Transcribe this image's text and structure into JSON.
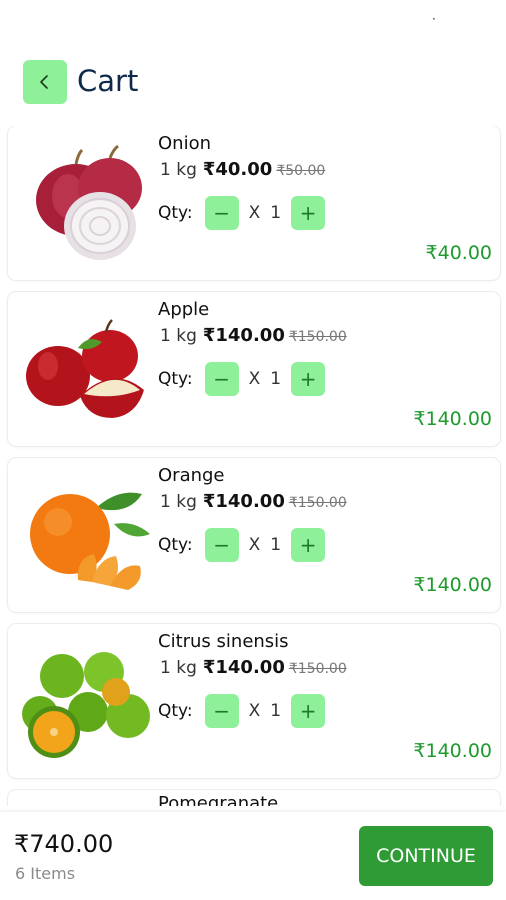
{
  "status": {
    "indicator": "·"
  },
  "header": {
    "back_icon": "chevron-left-icon",
    "title": "Cart"
  },
  "colors": {
    "accent_green": "#8ff09a",
    "price_green": "#1f9a2e",
    "button_green": "#2e9b35"
  },
  "cart": {
    "qty_label": "Qty:",
    "minus": "−",
    "plus": "+",
    "times": "X",
    "items": [
      {
        "name": "Onion",
        "unit": "1 kg",
        "price": "₹40.00",
        "mrp": "₹50.00",
        "quantity": "1",
        "total": "₹40.00",
        "image": "onion"
      },
      {
        "name": "Apple",
        "unit": "1 kg",
        "price": "₹140.00",
        "mrp": "₹150.00",
        "quantity": "1",
        "total": "₹140.00",
        "image": "apple"
      },
      {
        "name": "Orange",
        "unit": "1 kg",
        "price": "₹140.00",
        "mrp": "₹150.00",
        "quantity": "1",
        "total": "₹140.00",
        "image": "orange"
      },
      {
        "name": "Citrus sinensis",
        "unit": "1 kg",
        "price": "₹140.00",
        "mrp": "₹150.00",
        "quantity": "1",
        "total": "₹140.00",
        "image": "citrus"
      }
    ],
    "peek_item": {
      "name": "Pomegranate"
    }
  },
  "footer": {
    "total": "₹740.00",
    "items_count": "6 Items",
    "continue_label": "CONTINUE"
  }
}
